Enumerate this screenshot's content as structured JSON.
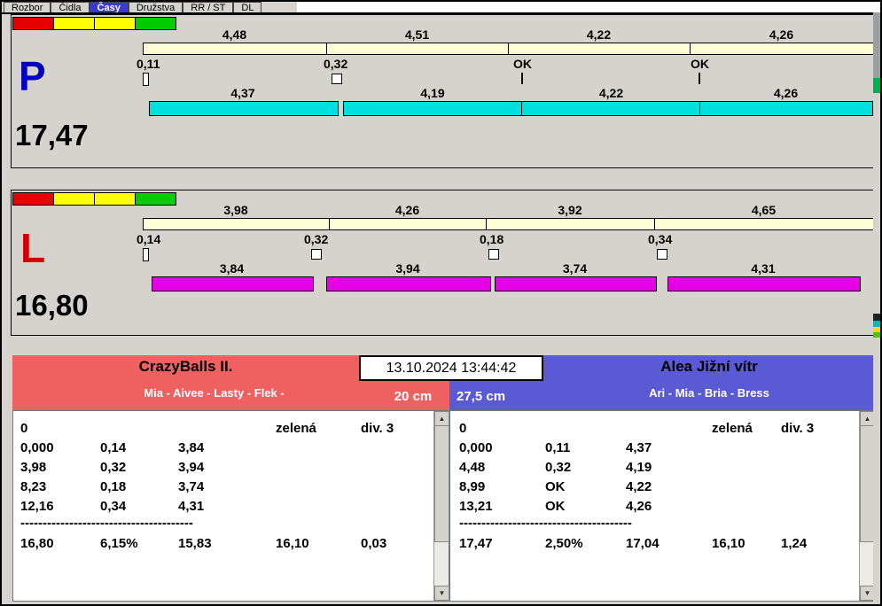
{
  "tabs": [
    {
      "label": "Rozbor"
    },
    {
      "label": "Čidla"
    },
    {
      "label": "Časy",
      "selected": true
    },
    {
      "label": "Družstva"
    },
    {
      "label": "RR / ST"
    },
    {
      "label": "DL"
    }
  ],
  "icons": {
    "scroll_up": "▲",
    "scroll_down": "▼"
  },
  "lanes": {
    "p": {
      "letter": "P",
      "total": "17,47",
      "splits": [
        "4,48",
        "4,51",
        "4,22",
        "4,26"
      ],
      "sensors": [
        "0,11",
        "0,32",
        "OK",
        "OK"
      ],
      "laps": [
        "4,37",
        "4,19",
        "4,22",
        "4,26"
      ],
      "bar_color": "#00dfdf",
      "letter_color": "#0000bd",
      "lights": [
        "#e60000",
        "#ffff00",
        "#ffff00",
        "#00cc00"
      ]
    },
    "l": {
      "letter": "L",
      "total": "16,80",
      "splits": [
        "3,98",
        "4,26",
        "3,92",
        "4,65"
      ],
      "sensors": [
        "0,14",
        "0,32",
        "0,18",
        "0,34"
      ],
      "laps": [
        "3,84",
        "3,94",
        "3,74",
        "4,31"
      ],
      "bar_color": "#e500e5",
      "letter_color": "#d40000",
      "lights": [
        "#e60000",
        "#ffff00",
        "#ffff00",
        "#00cc00"
      ]
    }
  },
  "scoreboard": {
    "timestamp": "13.10.2024 13:44:42",
    "left": {
      "team": "CrazyBalls II.",
      "lineup": "Mia - Aivee - Lasty - Flek -",
      "height": "20 cm",
      "header_color": "#ef6161",
      "rows": [
        [
          "0",
          "",
          "",
          "zelená",
          "div. 3"
        ],
        [
          "0,000",
          "0,14",
          "3,84",
          "",
          ""
        ],
        [
          "3,98",
          "0,32",
          "3,94",
          "",
          ""
        ],
        [
          "8,23",
          "0,18",
          "3,74",
          "",
          ""
        ],
        [
          "12,16",
          "0,34",
          "4,31",
          "",
          ""
        ]
      ],
      "separator": "---------------------------------------",
      "totals": [
        "16,80",
        "6,15%",
        "15,83",
        "16,10",
        "0,03"
      ]
    },
    "right": {
      "team": "Alea Jižní vítr",
      "lineup": "Ari - Mia - Bria - Bress",
      "height": "27,5 cm",
      "header_color": "#5a5ad4",
      "rows": [
        [
          "0",
          "",
          "",
          "zelená",
          "div. 3"
        ],
        [
          "0,000",
          "0,11",
          "4,37",
          "",
          ""
        ],
        [
          "4,48",
          "0,32",
          "4,19",
          "",
          ""
        ],
        [
          "8,99",
          "OK",
          "4,22",
          "",
          ""
        ],
        [
          "13,21",
          "OK",
          "4,26",
          "",
          ""
        ]
      ],
      "separator": "---------------------------------------",
      "totals": [
        "17,47",
        "2,50%",
        "17,04",
        "16,10",
        "1,24"
      ]
    }
  }
}
